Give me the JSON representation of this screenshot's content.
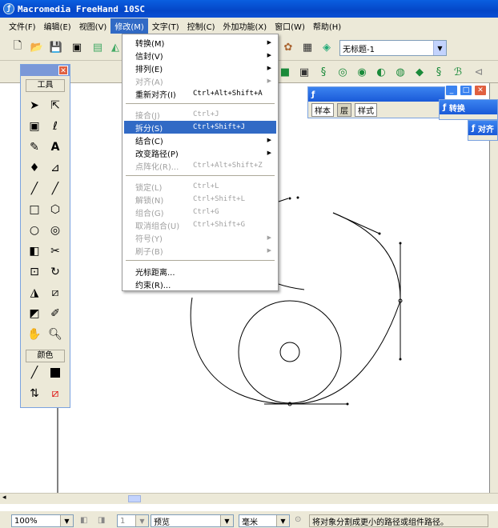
{
  "app": {
    "title": "Macromedia FreeHand 10SC"
  },
  "menubar": {
    "items": [
      {
        "label": "文件(F)"
      },
      {
        "label": "编辑(E)"
      },
      {
        "label": "视图(V)"
      },
      {
        "label": "修改(M)"
      },
      {
        "label": "文字(T)"
      },
      {
        "label": "控制(C)"
      },
      {
        "label": "外加功能(X)"
      },
      {
        "label": "窗口(W)"
      },
      {
        "label": "帮助(H)"
      }
    ]
  },
  "toolbar": {
    "document_dropdown": "无标题-1"
  },
  "toolbox": {
    "title": "工具",
    "color_section": "颜色"
  },
  "modify_menu": {
    "items": [
      {
        "label": "转换(M)",
        "shortcut": "",
        "submenu": true,
        "enabled": true
      },
      {
        "label": "信封(V)",
        "shortcut": "",
        "submenu": true,
        "enabled": true
      },
      {
        "label": "排列(E)",
        "shortcut": "",
        "submenu": true,
        "enabled": true
      },
      {
        "label": "对齐(A)",
        "shortcut": "",
        "submenu": true,
        "enabled": false
      },
      {
        "label": "重新对齐(I)",
        "shortcut": "Ctrl+Alt+Shift+A",
        "submenu": false,
        "enabled": true
      },
      {
        "label": "接合(J)",
        "shortcut": "Ctrl+J",
        "submenu": false,
        "enabled": false
      },
      {
        "label": "拆分(S)",
        "shortcut": "Ctrl+Shift+J",
        "submenu": false,
        "enabled": true,
        "highlighted": true
      },
      {
        "label": "结合(C)",
        "shortcut": "",
        "submenu": true,
        "enabled": true
      },
      {
        "label": "改变路径(P)",
        "shortcut": "",
        "submenu": true,
        "enabled": true
      },
      {
        "label": "点阵化(R)...",
        "shortcut": "Ctrl+Alt+Shift+Z",
        "submenu": false,
        "enabled": false
      },
      {
        "label": "锁定(L)",
        "shortcut": "Ctrl+L",
        "submenu": false,
        "enabled": false
      },
      {
        "label": "解锁(N)",
        "shortcut": "Ctrl+Shift+L",
        "submenu": false,
        "enabled": false
      },
      {
        "label": "组合(G)",
        "shortcut": "Ctrl+G",
        "submenu": false,
        "enabled": false
      },
      {
        "label": "取消组合(U)",
        "shortcut": "Ctrl+Shift+G",
        "submenu": false,
        "enabled": false
      },
      {
        "label": "符号(Y)",
        "shortcut": "",
        "submenu": true,
        "enabled": false
      },
      {
        "label": "刷子(B)",
        "shortcut": "",
        "submenu": true,
        "enabled": false
      },
      {
        "label": "光标距离...",
        "shortcut": "",
        "submenu": false,
        "enabled": true
      },
      {
        "label": "约束(R)...",
        "shortcut": "",
        "submenu": false,
        "enabled": true
      }
    ]
  },
  "panels": {
    "tabs": {
      "sample": "样本",
      "layers": "层",
      "styles": "样式"
    },
    "transform": "转换",
    "align": "对齐"
  },
  "statusbar": {
    "zoom": "100%",
    "page_number": "1",
    "view_mode": "预览",
    "units": "毫米",
    "hint": "将对象分割成更小的路径或组件路径。"
  },
  "colors": {
    "titlebar": "#0a4fd4",
    "menu_highlight": "#316ac5",
    "chrome": "#ece9d8"
  }
}
